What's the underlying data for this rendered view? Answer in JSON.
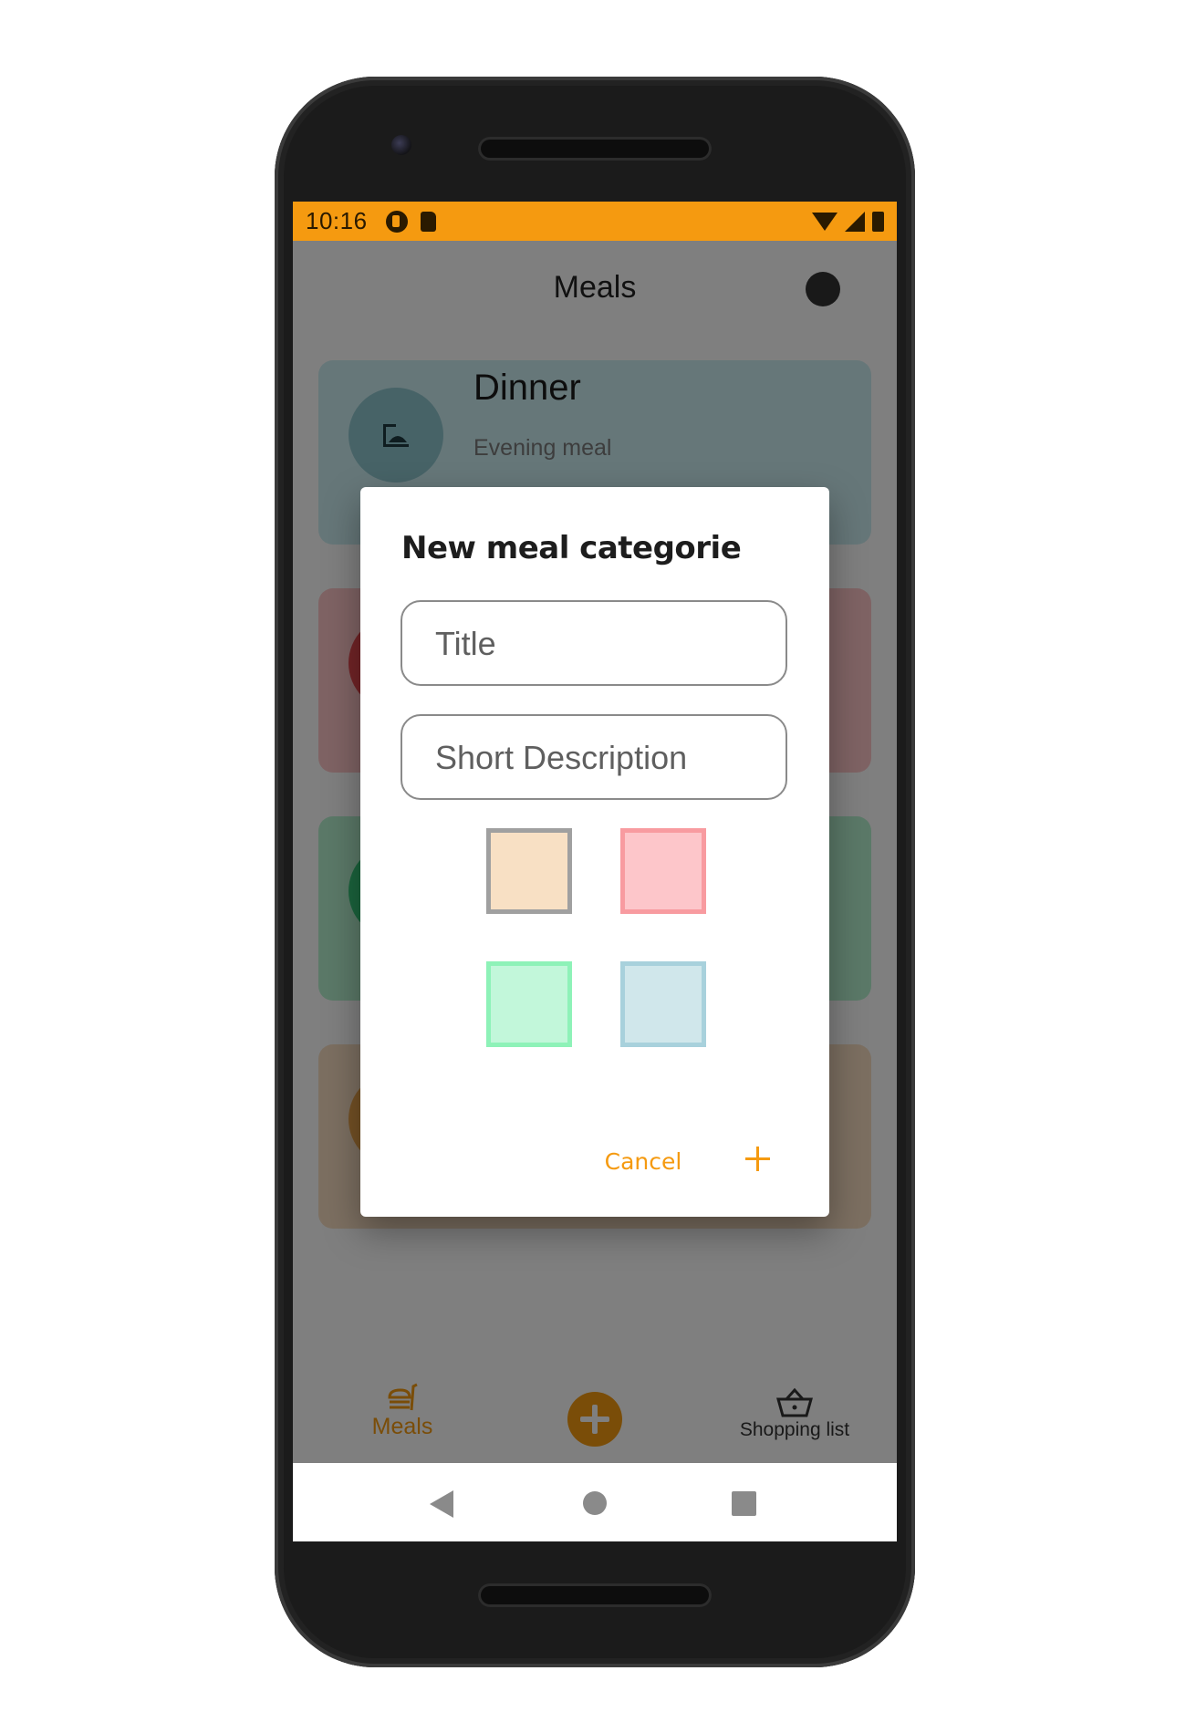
{
  "status_bar": {
    "time": "10:16"
  },
  "app_bar": {
    "title": "Meals"
  },
  "cards": [
    {
      "title": "Dinner",
      "subtitle": "Evening meal",
      "color": "#cdeef2"
    },
    {
      "title": "",
      "subtitle": "",
      "color": "#ffc7c9"
    },
    {
      "title": "",
      "subtitle": "",
      "color": "#b6f3d0"
    },
    {
      "title": "",
      "subtitle": "",
      "color": "#f8dec2"
    }
  ],
  "dialog": {
    "title": "New meal categorie",
    "title_field": {
      "placeholder": "Title",
      "value": ""
    },
    "description_field": {
      "placeholder": "Short Description",
      "value": ""
    },
    "color_options": [
      "#f8e0c4",
      "#fdc6ca",
      "#c2f7da",
      "#d0e7eb"
    ],
    "selected_color_index": 0,
    "cancel_label": "Cancel",
    "add_icon": "plus-icon"
  },
  "bottom_nav": {
    "meals_label": "Meals",
    "add_icon": "plus-icon",
    "shopping_label": "Shopping list"
  },
  "accent_color": "#F59A10"
}
